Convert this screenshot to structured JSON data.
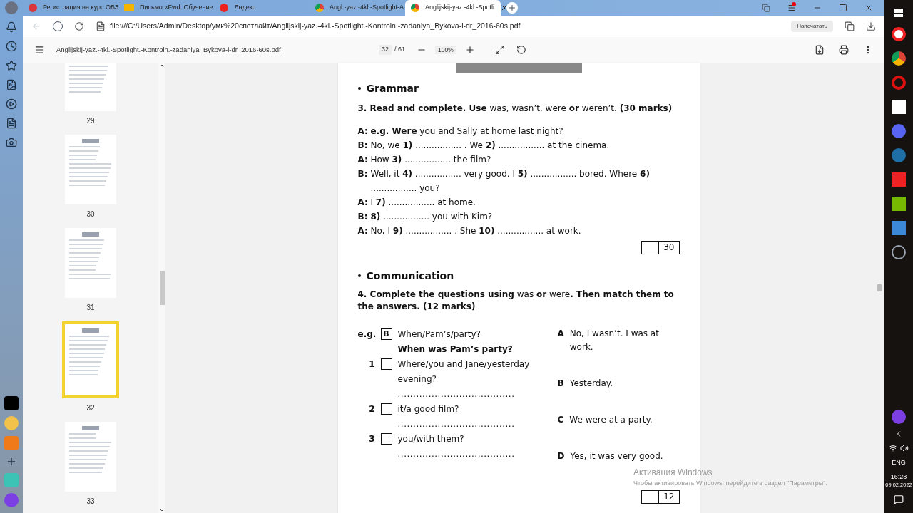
{
  "tabs": [
    {
      "title": "Регистрация на курс ОВЗ",
      "selected": false
    },
    {
      "title": "Письмо «Fwd: Обучение",
      "selected": false
    },
    {
      "title": "Яндекс",
      "selected": false
    },
    {
      "title": "Angl.-yaz.-4kl.-Spotlight-A",
      "selected": false
    },
    {
      "title": "Anglijskij-yaz.-4kl.-Spotli",
      "selected": true
    }
  ],
  "address_bar": {
    "url": "file:///C:/Users/Admin/Desktop/умк%20спотлайт/Anglijskij-yaz.-4kl.-Spotlight.-Kontroln.-zadaniya_Bykova-i-dr_2016-60s.pdf",
    "print_button": "Напечатать"
  },
  "pdf_toolbar": {
    "file_name": "Anglijskij-yaz.-4kl.-Spotlight.-Kontroln.-zadaniya_Bykova-i-dr_2016-60s.pdf",
    "page": "32",
    "page_total": "/ 61",
    "zoom": "100%"
  },
  "thumbnails": [
    {
      "label": "29",
      "selected": false
    },
    {
      "label": "30",
      "selected": false
    },
    {
      "label": "31",
      "selected": false
    },
    {
      "label": "32",
      "selected": true
    },
    {
      "label": "33",
      "selected": false
    }
  ],
  "document": {
    "grammar": {
      "heading": "Grammar",
      "task": "**3. Read and complete. Use** was, wasn’t, were **or** weren’t. **(30 marks)**",
      "lines": [
        {
          "speaker": "A:",
          "text": "**e.g. Were** you and Sally at home last night?"
        },
        {
          "speaker": "B:",
          "text": "No, we **1)** ................. . We **2)** ................. at the cinema."
        },
        {
          "speaker": "A:",
          "text": "How **3)** ................. the film?"
        },
        {
          "speaker": "B:",
          "text": "Well, it **4)** ................. very good. I **5)** ................. bored. Where **6)** ................. you?"
        },
        {
          "speaker": "A:",
          "text": "I **7)** ................. at home."
        },
        {
          "speaker": "B:",
          "text": "**8)** ................. you with Kim?"
        },
        {
          "speaker": "A:",
          "text": "No, I **9)** ................. .  She **10)** ................. at work."
        }
      ],
      "score": "30"
    },
    "communication": {
      "heading": "Communication",
      "task": "**4. Complete the questions using** was **or** were**. Then match them to the answers. (12 marks)**",
      "questions": [
        {
          "number": "e.g.",
          "box": "B",
          "prompt": "When/Pam’s/party?",
          "answer": "When was Pam’s party?"
        },
        {
          "number": "1",
          "prompt": "Where/you and Jane/yesterday evening?",
          "answer": "......................................"
        },
        {
          "number": "2",
          "prompt": "it/a good film?",
          "answer": "......................................"
        },
        {
          "number": "3",
          "prompt": "you/with them?",
          "answer": "......................................"
        }
      ],
      "answers": [
        {
          "letter": "A",
          "text": "No, I wasn’t. I was at work."
        },
        {
          "letter": "B",
          "text": "Yesterday."
        },
        {
          "letter": "C",
          "text": "We were at a party."
        },
        {
          "letter": "D",
          "text": "Yes, it was very good."
        }
      ],
      "score": "12"
    }
  },
  "activation": {
    "title": "Активация Windows",
    "text": "Чтобы активировать Windows, перейдите в раздел \"Параметры\"."
  },
  "taskbar": {
    "language": "ENG",
    "time": "16:28",
    "date": "09.02.2022"
  }
}
